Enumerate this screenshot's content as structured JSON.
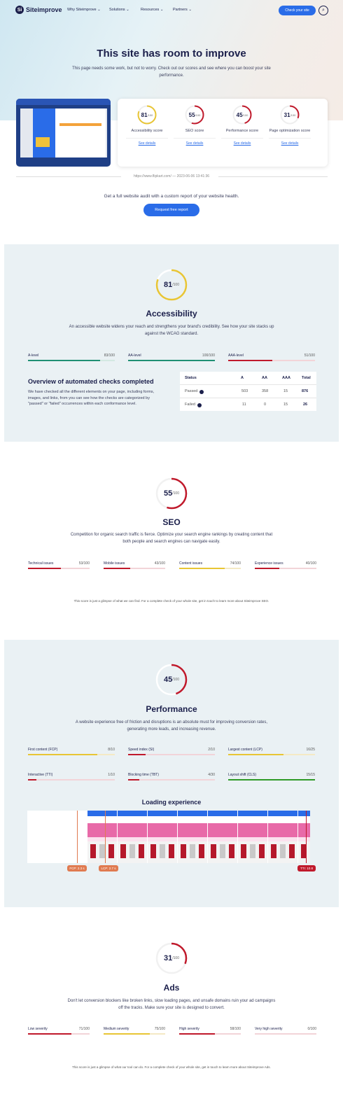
{
  "nav": {
    "logo_mark": "Si",
    "logo": "Siteimprove",
    "items": [
      "Why Siteimprove",
      "Solutions",
      "Resources",
      "Partners"
    ],
    "cta": "Check your site",
    "search_icon": "search-icon"
  },
  "hero": {
    "title": "This site has room to improve",
    "subtitle": "This page needs some work, but not to worry. Check out our scores and see where you can boost your site performance."
  },
  "scores": [
    {
      "value": 81,
      "max": "/100",
      "label": "Accessibility score",
      "link": "See details",
      "color": "#e8c534"
    },
    {
      "value": 55,
      "max": "/100",
      "label": "SEO score",
      "link": "See details",
      "color": "#c0192b"
    },
    {
      "value": 45,
      "max": "/100",
      "label": "Performance score",
      "link": "See details",
      "color": "#c0192b"
    },
    {
      "value": 31,
      "max": "/100",
      "label": "Page optimization score",
      "link": "See details",
      "color": "#c0192b"
    }
  ],
  "meta": "https://www.flipkart.com/ — 2023-06-06 13:41:36",
  "audit": {
    "text": "Get a full website audit with a custom report of your website health.",
    "button": "Request free report"
  },
  "accessibility": {
    "score": 81,
    "max": "/100",
    "title": "Accessibility",
    "desc": "An accessible website widens your reach and strengthens your brand's credibility. See how your site stacks up against the WCAG standard.",
    "levels": [
      {
        "label": "A-level",
        "value": "83/100",
        "pct": 0.83,
        "color": "#1f8f73"
      },
      {
        "label": "AA-level",
        "value": "100/100",
        "pct": 1.0,
        "color": "#1f8f73"
      },
      {
        "label": "AAA-level",
        "value": "51/100",
        "pct": 0.51,
        "color": "#c0192b"
      }
    ],
    "checks_title": "Overview of automated checks completed",
    "checks_desc": "We have checked all the different elements on your page, including forms, images, and links, from you can see how the checks are categorized by \"passed\" or \"failed\" occurrences within each conformance level.",
    "table": {
      "headers": [
        "Status",
        "A",
        "AA",
        "AAA",
        "Total"
      ],
      "rows": [
        [
          "Passed",
          "503",
          "358",
          "15",
          "876"
        ],
        [
          "Failed",
          "11",
          "0",
          "15",
          "26"
        ]
      ]
    }
  },
  "seo": {
    "score": 55,
    "max": "/100",
    "title": "SEO",
    "desc": "Competition for organic search traffic is fierce. Optimize your search engine rankings by creating content that both people and search engines can navigate easily.",
    "bars": [
      {
        "label": "Technical issues",
        "value": "53/100",
        "pct": 0.53,
        "color": "#c0192b"
      },
      {
        "label": "Mobile issues",
        "value": "43/100",
        "pct": 0.43,
        "color": "#c0192b"
      },
      {
        "label": "Content issues",
        "value": "74/100",
        "pct": 0.74,
        "color": "#e8c534"
      },
      {
        "label": "Experience issues",
        "value": "40/100",
        "pct": 0.4,
        "color": "#c0192b"
      }
    ],
    "note": "This score is just a glimpse of what we can find. For a complete check of your whole site, get in touch to learn more about Siteimprove SEO."
  },
  "performance": {
    "score": 45,
    "max": "/100",
    "title": "Performance",
    "desc": "A website experience free of friction and disruptions is an absolute must for improving conversion rates, generating more leads, and increasing revenue.",
    "bars": [
      {
        "label": "First content (FCP)",
        "value": "8/10",
        "pct": 0.8,
        "color": "#e8c534"
      },
      {
        "label": "Speed index (SI)",
        "value": "2/10",
        "pct": 0.2,
        "color": "#c0192b"
      },
      {
        "label": "Largest content (LCP)",
        "value": "16/25",
        "pct": 0.64,
        "color": "#e8c534"
      },
      {
        "label": "Interactive (TTI)",
        "value": "1/10",
        "pct": 0.1,
        "color": "#c0192b"
      },
      {
        "label": "Blocking time (TBT)",
        "value": "4/30",
        "pct": 0.13,
        "color": "#c0192b"
      },
      {
        "label": "Layout shift (CLS)",
        "value": "15/15",
        "pct": 1.0,
        "color": "#2f9a27"
      }
    ],
    "loading_title": "Loading experience",
    "markers": [
      {
        "label": "FCP: 2.3 s",
        "color": "#e07a50"
      },
      {
        "label": "LCP: 2.7 s",
        "color": "#e07a50"
      },
      {
        "label": "TTI: 10.8",
        "color": "#c0192b"
      }
    ]
  },
  "ads": {
    "score": 31,
    "max": "/100",
    "title": "Ads",
    "desc": "Don't let conversion blockers like broken links, slow loading pages, and unsafe domains ruin your ad campaigns off the tracks. Make sure your site is designed to convert.",
    "bars": [
      {
        "label": "Low severity",
        "value": "71/100",
        "pct": 0.71,
        "color": "#c0192b"
      },
      {
        "label": "Medium severity",
        "value": "75/100",
        "pct": 0.75,
        "color": "#e8c534"
      },
      {
        "label": "High severity",
        "value": "58/100",
        "pct": 0.58,
        "color": "#c0192b"
      },
      {
        "label": "Very high severity",
        "value": "0/100",
        "pct": 0.0,
        "color": "#c0192b"
      }
    ],
    "note": "This score is just a glimpse of what our tool can do. For a complete check of your whole site, get in touch to learn more about Siteimprove Ads."
  }
}
